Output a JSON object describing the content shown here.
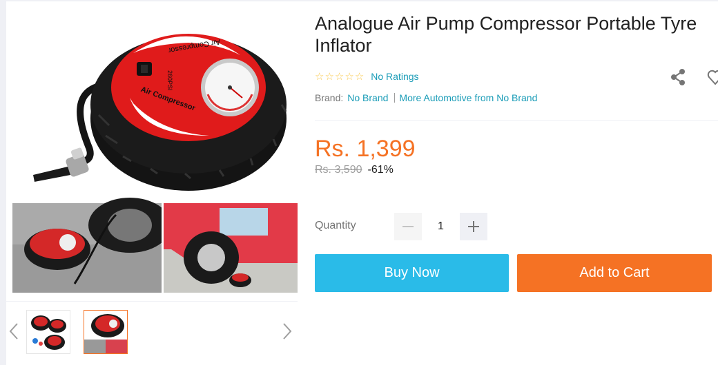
{
  "product": {
    "title": "Analogue Air Pump Compressor Portable Tyre Inflator",
    "rating_text": "No Ratings",
    "brand_label": "Brand:",
    "brand_name": "No Brand",
    "more_from": "More Automotive from No Brand",
    "price": "Rs. 1,399",
    "original_price": "Rs. 3,590",
    "discount": "-61%"
  },
  "image_text": {
    "label_top": "Air Compressor",
    "label_bottom": "Air Compressor",
    "psi_text": "260PSI"
  },
  "quantity": {
    "label": "Quantity",
    "value": "1"
  },
  "actions": {
    "buy_now": "Buy Now",
    "add_to_cart": "Add to Cart"
  },
  "colors": {
    "brand_orange": "#f57224",
    "link_blue": "#1a9cb7",
    "buy_blue": "#2abbe8",
    "star_yellow": "#faca51"
  },
  "icons": {
    "share": "share-icon",
    "wishlist": "heart-icon",
    "minus": "minus-icon",
    "plus": "plus-icon",
    "prev": "chevron-left-icon",
    "next": "chevron-right-icon",
    "star": "star-outline-icon"
  }
}
